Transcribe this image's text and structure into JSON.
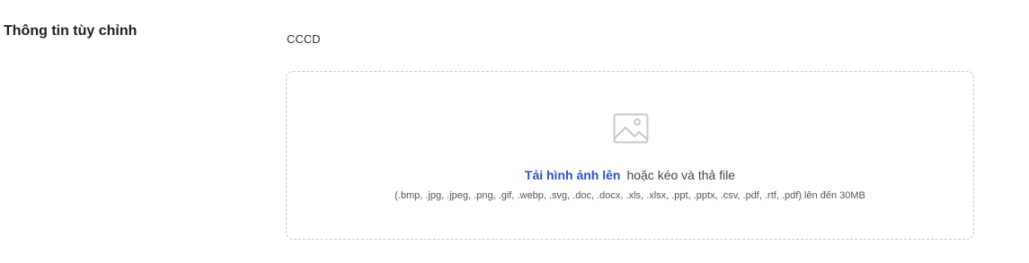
{
  "section": {
    "title": "Thông tin tùy chỉnh"
  },
  "field": {
    "label": "CCCD"
  },
  "upload": {
    "icon": "image-placeholder-icon",
    "link_text": "Tải hình ảnh lên",
    "drag_text": "hoặc kéo và thả file",
    "formats_text": "(.bmp, .jpg, .jpeg, .png, .gif, .webp, .svg, .doc, .docx, .xls, .xlsx, .ppt, .pptx, .csv, .pdf, .rtf, .pdf) lên đến 30MB",
    "link_color": "#2b52c9",
    "border_color": "#c9c9cf"
  }
}
